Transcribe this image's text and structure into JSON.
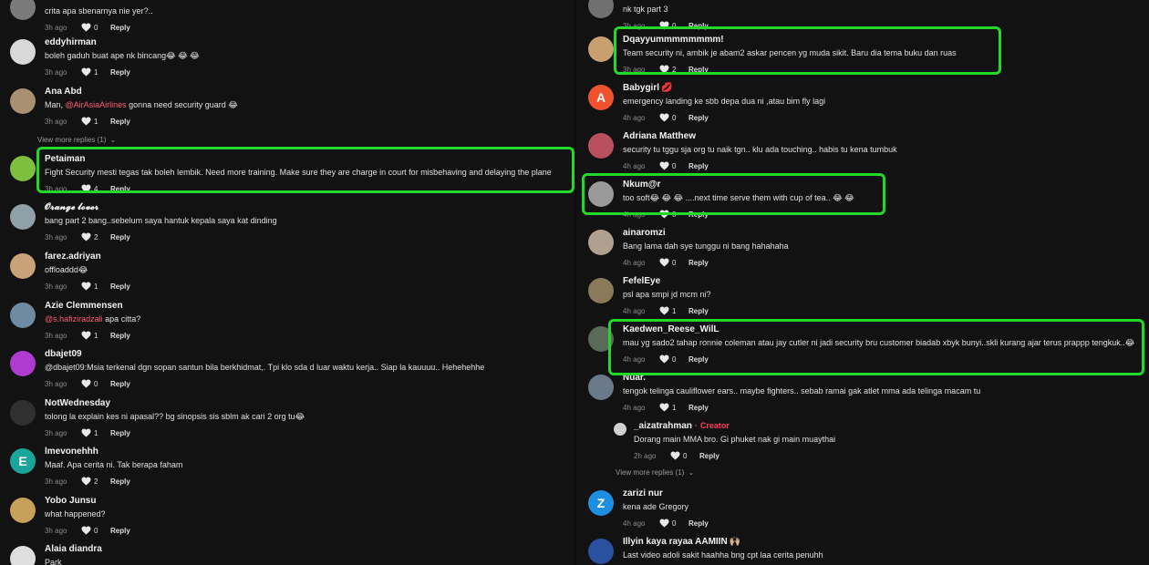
{
  "left_comments": [
    {
      "name": "",
      "text": "crita apa sbenarnya nie yer?..",
      "time": "3h ago",
      "likes": "0",
      "reply": "Reply",
      "avatar": "photo",
      "avatar_color": "#7a7a7a"
    },
    {
      "name": "eddyhirman",
      "text": "boleh gaduh buat ape nk bincang😂 😂 😂",
      "time": "3h ago",
      "likes": "1",
      "reply": "Reply",
      "avatar": "photo",
      "avatar_color": "#d8d8d8"
    },
    {
      "name": "Ana Abd",
      "text_parts": [
        "Man, ",
        "@AirAsiaAirlines",
        " gonna need security guard 😂"
      ],
      "time": "3h ago",
      "likes": "1",
      "reply": "Reply",
      "avatar": "photo",
      "avatar_color": "#a89070",
      "view_more": "View more replies (1)"
    },
    {
      "name": "Petaiman",
      "text": "Fight Security mesti tegas tak boleh lembik. Need more training. Make sure they are charge in court for misbehaving and delaying the plane",
      "time": "3h ago",
      "likes": "4",
      "reply": "Reply",
      "avatar": "photo",
      "avatar_color": "#7fbf3f"
    },
    {
      "name": "𝓞𝓻𝓪𝓷𝓰𝓮 𝓵𝓸𝓿𝓮𝓻",
      "text": "bang part 2 bang..sebelum saya hantuk kepala saya kat dinding",
      "time": "3h ago",
      "likes": "2",
      "reply": "Reply",
      "avatar": "photo",
      "avatar_color": "#8fa0a8"
    },
    {
      "name": "farez.adriyan",
      "text": "offloaddd😂",
      "time": "3h ago",
      "likes": "1",
      "reply": "Reply",
      "avatar": "photo",
      "avatar_color": "#c9a27a"
    },
    {
      "name": "Azie Clemmensen",
      "text_parts": [
        "",
        "@s.hafiziradzali",
        " apa citta?"
      ],
      "time": "3h ago",
      "likes": "1",
      "reply": "Reply",
      "avatar": "photo",
      "avatar_color": "#6f8aa3"
    },
    {
      "name": "dbajet09",
      "text": "@dbajet09:Msia terkenal dgn sopan santun bila berkhidmat,. Tpi klo sda d luar waktu kerja.. Siap la kauuuu.. Hehehehhe",
      "time": "3h ago",
      "likes": "0",
      "reply": "Reply",
      "avatar": "photo",
      "avatar_color": "#b03bd0"
    },
    {
      "name": "NotWednesday",
      "text": "tolong la explain kes ni apasal?? bg sinopsis sis sblm ak cari 2 org tu😂",
      "time": "3h ago",
      "likes": "1",
      "reply": "Reply",
      "avatar": "photo",
      "avatar_color": "#303030"
    },
    {
      "name": "lmevonehhh",
      "text": "Maaf. Apa cerita ni. Tak berapa faham",
      "time": "3h ago",
      "likes": "2",
      "reply": "Reply",
      "avatar": "letter",
      "letter": "E",
      "avatar_color": "#1aa59a"
    },
    {
      "name": "Yobo Junsu",
      "text": "what happened?",
      "time": "3h ago",
      "likes": "0",
      "reply": "Reply",
      "avatar": "photo",
      "avatar_color": "#c7a05a"
    },
    {
      "name": "Alaia diandra",
      "text": "Park",
      "time": "",
      "likes": "",
      "reply": "",
      "avatar": "photo",
      "avatar_color": "#dedede"
    }
  ],
  "right_comments": [
    {
      "name": "",
      "text": "nk tgk part 3",
      "time": "3h ago",
      "likes": "0",
      "reply": "Reply",
      "avatar": "photo",
      "avatar_color": "#707070"
    },
    {
      "name": "Dqayyummmmmmmm!",
      "text": "Team security ni, ambik je abam2 askar pencen yg muda sikit. Baru dia tema buku dan ruas",
      "time": "3h ago",
      "likes": "2",
      "reply": "Reply",
      "avatar": "photo",
      "avatar_color": "#c8a070"
    },
    {
      "name": "Babygirl",
      "badge": "💋",
      "text": "emergency landing ke sbb depa dua ni ,atau bim fly lagi",
      "time": "4h ago",
      "likes": "0",
      "reply": "Reply",
      "avatar": "letter",
      "letter": "A",
      "avatar_color": "#f0522e"
    },
    {
      "name": "Adriana Matthew",
      "text": "security tu tggu sja org tu naik tgn.. klu ada touching.. habis tu kena tumbuk",
      "time": "4h ago",
      "likes": "0",
      "reply": "Reply",
      "avatar": "photo",
      "avatar_color": "#b85060"
    },
    {
      "name": "Nkum@r",
      "text": "too soft😂 😂 😂 ....next time serve them with cup of tea.. 😂 😂",
      "time": "4h ago",
      "likes": "0",
      "reply": "Reply",
      "avatar": "photo",
      "avatar_color": "#9a9a9a"
    },
    {
      "name": "ainaromzi",
      "text": "Bang lama dah sye tunggu ni bang hahahaha",
      "time": "4h ago",
      "likes": "0",
      "reply": "Reply",
      "avatar": "photo",
      "avatar_color": "#b0a090"
    },
    {
      "name": "FefelEye",
      "text": "psl apa smpi jd mcm ni?",
      "time": "4h ago",
      "likes": "1",
      "reply": "Reply",
      "avatar": "photo",
      "avatar_color": "#8a7a5a"
    },
    {
      "name": "Kaedwen_Reese_WilL",
      "text": "mau yg sado2 tahap ronnie coleman atau jay cutler ni jadi security bru customer biadab xbyk bunyi..skli kurang ajar terus prappp tengkuk..😂",
      "time": "4h ago",
      "likes": "0",
      "reply": "Reply",
      "avatar": "photo",
      "avatar_color": "#5a6a5a"
    },
    {
      "name": "Nuar.",
      "text": "tengok telinga cauliflower ears.. maybe fighters.. sebab ramai gak atlet mma ada telinga macam tu",
      "time": "4h ago",
      "likes": "1",
      "reply": "Reply",
      "avatar": "photo",
      "avatar_color": "#6a7a8a"
    },
    {
      "name": "_aizatrahman",
      "creator": "Creator",
      "text": "Dorang main MMA bro. Gi phuket nak gi main muaythai",
      "time": "2h ago",
      "likes": "0",
      "reply": "Reply",
      "avatar": "photo",
      "avatar_color": "#d0d0d0",
      "is_reply": true,
      "view_more": "View more replies (1)"
    },
    {
      "name": "zarizi nur",
      "text": "kena ade Gregory",
      "time": "4h ago",
      "likes": "0",
      "reply": "Reply",
      "avatar": "letter",
      "letter": "Z",
      "avatar_color": "#1e8fe0"
    },
    {
      "name": "Illyin kaya rayaa AAMIIN",
      "badge": "🙌🏼",
      "text": "Last video adoli sakit haahha bng cpt laa cerita penuhh",
      "time": "",
      "likes": "",
      "reply": "",
      "avatar": "photo",
      "avatar_color": "#2a50a0"
    }
  ]
}
